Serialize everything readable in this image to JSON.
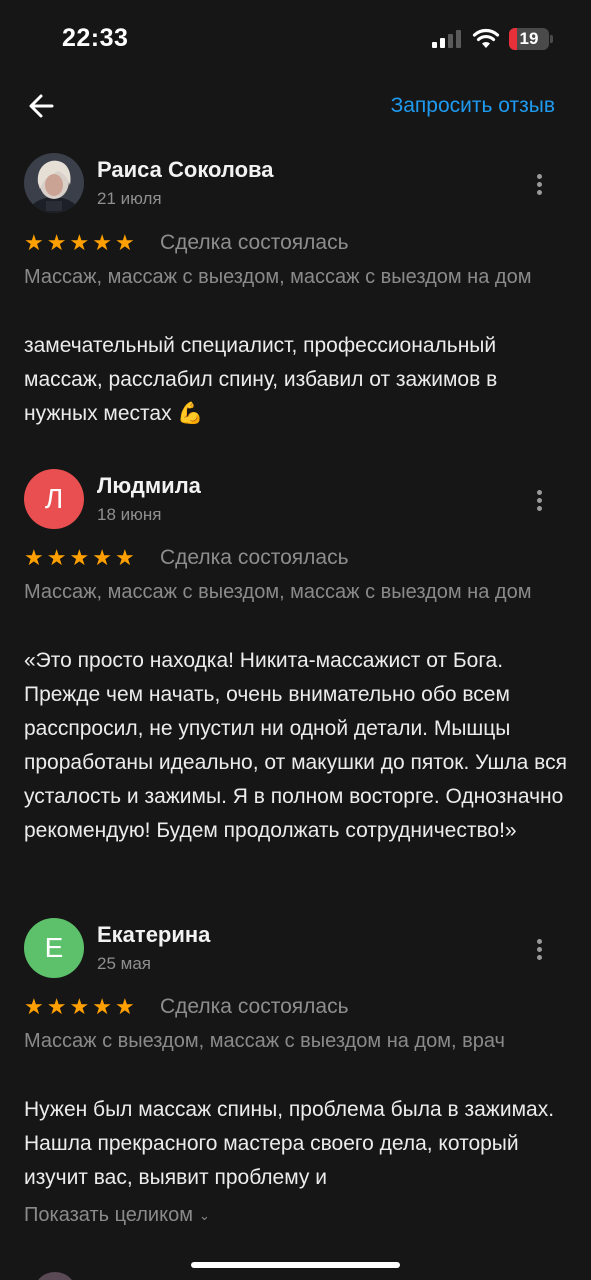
{
  "status_bar": {
    "time": "22:33",
    "battery_level": "19",
    "battery_percent": 19
  },
  "nav": {
    "request_review_label": "Запросить отзыв"
  },
  "reviews": [
    {
      "name": "Раиса Соколова",
      "date": "21 июля",
      "rating": 5,
      "deal_status": "Сделка состоялась",
      "services": "Массаж, массаж с выездом, массаж с выездом на дом",
      "text": "замечательный специалист, профессиональный массаж, расслабил спину, избавил от зажимов в нужных местах 💪",
      "avatar": "photo"
    },
    {
      "name": "Людмила",
      "date": "18 июня",
      "rating": 5,
      "deal_status": "Сделка состоялась",
      "services": "Массаж, массаж с выездом, массаж с выездом на дом",
      "text": "«Это просто находка! Никита-массажист от Бога. Прежде чем начать, очень  внимательно обо всем расспросил, не упустил ни одной детали. Мышцы проработаны идеально, от макушки до пяток. Ушла вся усталость и зажимы. Я в полном восторге. Однозначно рекомендую! Будем продолжать сотрудничество!»",
      "avatar_letter": "Л",
      "avatar_color": "#e94f50"
    },
    {
      "name": "Екатерина",
      "date": "25 мая",
      "rating": 5,
      "deal_status": "Сделка состоялась",
      "services": "Массаж с выездом, массаж с выездом на дом, врач",
      "text": "Нужен был массаж спины, проблема была в зажимах. Нашла прекрасного мастера своего дела, который изучит вас, выявит проблему и",
      "avatar_letter": "Е",
      "avatar_color": "#5cc16a",
      "show_more_label": "Показать целиком"
    }
  ],
  "colors": {
    "background": "#161616",
    "accent": "#1e9bf0",
    "star": "#ffa000",
    "muted_text": "#8a8a8a",
    "battery_alert": "#e8303a"
  },
  "icons": [
    "back-arrow-icon",
    "more-vertical-icon",
    "star-icon",
    "chevron-down-icon",
    "cellular-signal-icon",
    "wifi-icon",
    "battery-icon"
  ]
}
